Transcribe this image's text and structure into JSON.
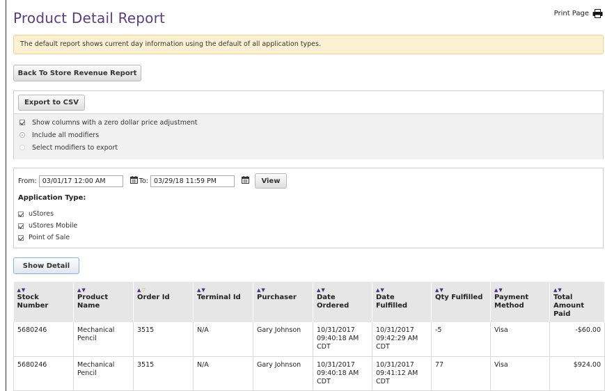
{
  "page": {
    "title": "Product Detail Report",
    "print_label": "Print Page",
    "notice": "The default report shows current day information using the default of all application types."
  },
  "buttons": {
    "back": "Back To Store Revenue Report",
    "export_csv": "Export to CSV",
    "view": "View",
    "show_detail": "Show Detail"
  },
  "export_options": {
    "zero_price": "Show columns with a zero dollar price adjustment",
    "include_all": "Include all modifiers",
    "select_modifiers": "Select modifiers to export"
  },
  "filter": {
    "from_label": "From:",
    "from_value": "03/01/17 12:00 AM",
    "to_label": "To:",
    "to_value": "03/29/18 11:59 PM",
    "application_type_label": "Application Type:",
    "app_types": [
      "uStores",
      "uStores Mobile",
      "Point of Sale"
    ]
  },
  "table": {
    "headers": [
      "Stock Number",
      "Product Name",
      "Order Id",
      "Terminal Id",
      "Purchaser",
      "Date Ordered",
      "Date Fulfilled",
      "Qty Fulfilled",
      "Payment Method",
      "Total Amount Paid"
    ],
    "rows": [
      {
        "stock": "5680246",
        "product": "Mechanical Pencil",
        "order": "3515",
        "terminal": "N/A",
        "purchaser": "Gary Johnson",
        "date_ordered": "10/31/2017 09:40:18 AM CDT",
        "date_fulfilled": "10/31/2017 09:42:29 AM CDT",
        "qty": "-5",
        "payment": "Visa",
        "total": "-$60.00"
      },
      {
        "stock": "5680246",
        "product": "Mechanical Pencil",
        "order": "3515",
        "terminal": "N/A",
        "purchaser": "Gary Johnson",
        "date_ordered": "10/31/2017 09:40:18 AM CDT",
        "date_fulfilled": "10/31/2017 09:41:12 AM CDT",
        "qty": "77",
        "payment": "Visa",
        "total": "$924.00"
      }
    ]
  },
  "icons": {
    "print": "printer-icon",
    "calendar": "calendar-icon",
    "sort": "sort-arrows-icon"
  },
  "colors": {
    "title": "#5a3d7a",
    "sort_arrow": "#4b2f7a",
    "sort_active": "#f0b429",
    "notice_bg": "#fcf1d2"
  }
}
